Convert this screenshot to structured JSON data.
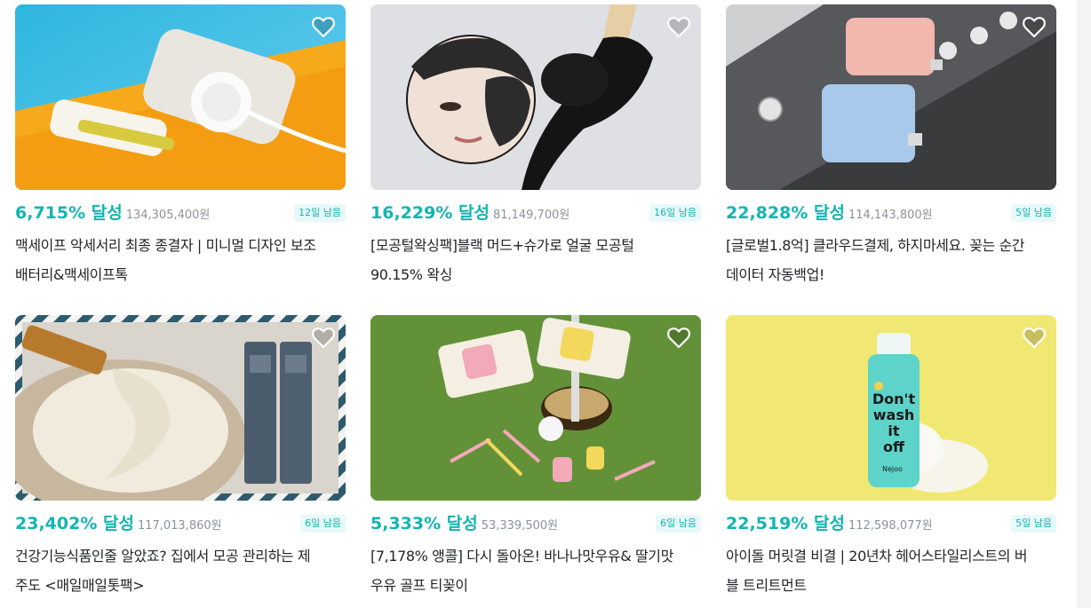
{
  "projects": [
    {
      "rate": "6,715% 달성",
      "amount": "134,305,400원",
      "days_left": "12일 남음",
      "title_line1": "맥세이프 악세서리 최종 종결자 | 미니멀 디자인 보조",
      "title_line2": "배터리&맥세이프톡",
      "image": "battery-magsafe-photo"
    },
    {
      "rate": "16,229% 달성",
      "amount": "81,149,700원",
      "days_left": "16일 남음",
      "title_line1": "[모공털왁싱팩]블랙 머드+슈가로 얼굴 모공털",
      "title_line2": "90.15% 왁싱",
      "image": "black-mud-wax-photo"
    },
    {
      "rate": "22,828% 달성",
      "amount": "114,143,800원",
      "days_left": "5일 남음",
      "title_line1": "[글로벌1.8억] 클라우드결제, 하지마세요. 꽂는 순간",
      "title_line2": "데이터 자동백업!",
      "image": "photofast-usb-photo"
    },
    {
      "rate": "23,402% 달성",
      "amount": "117,013,860원",
      "days_left": "6일 남음",
      "title_line1": "건강기능식품인줄 알았죠? 집에서 모공 관리하는 제",
      "title_line2": "주도 <매일매일톳팩>",
      "image": "seaweed-pack-photo"
    },
    {
      "rate": "5,333% 달성",
      "amount": "53,339,500원",
      "days_left": "6일 남음",
      "title_line1": "[7,178% 앵콜] 다시 돌아온! 바나나맛우유& 딸기맛",
      "title_line2": "우유 골프 티꽂이",
      "image": "golf-tee-photo"
    },
    {
      "rate": "22,519% 달성",
      "amount": "112,598,077원",
      "days_left": "5일 남음",
      "title_line1": "아이돌 머릿결 비결 | 20년차 헤어스타일리스트의 버",
      "title_line2": "블 트리트먼트",
      "image": "dont-wash-it-off-photo",
      "product_text": [
        "Don't",
        "wash",
        "it",
        "off",
        "Nejoo"
      ]
    }
  ],
  "icons": {
    "wish": "heart-icon"
  },
  "colors": {
    "accent": "#13b5b1",
    "badge_bg": "#e7f9f9",
    "amount": "#8a939b"
  }
}
